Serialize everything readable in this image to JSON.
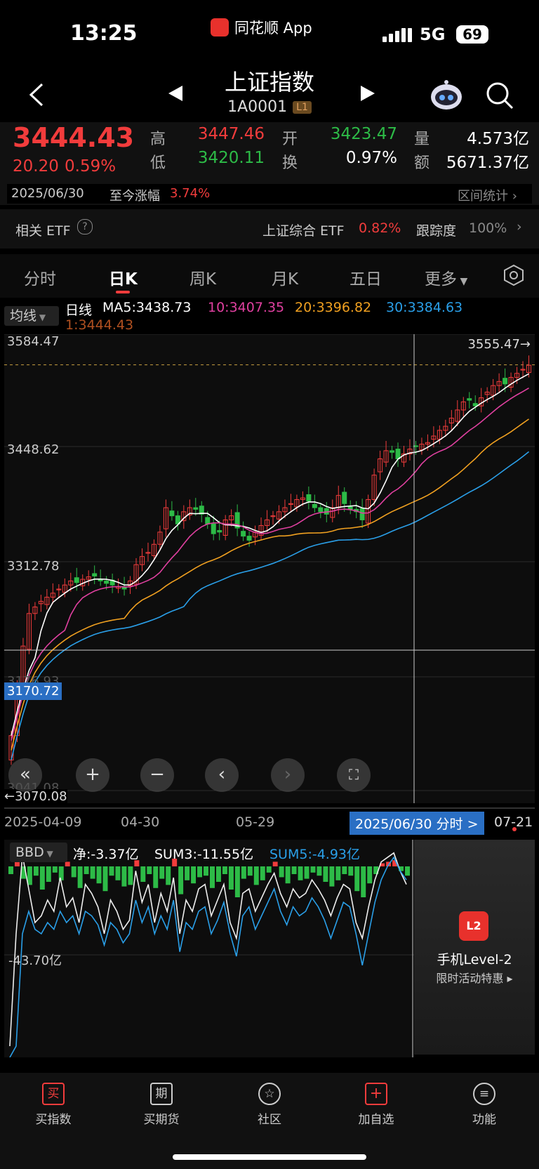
{
  "status": {
    "time": "13:25",
    "app_name": "同花顺 App",
    "network": "5G",
    "battery": "69"
  },
  "header": {
    "title": "上证指数",
    "code": "1A0001",
    "level_badge": "L1"
  },
  "quote": {
    "price": "3444.43",
    "change": "20.20",
    "change_pct": "0.59%",
    "high_label": "高",
    "high": "3447.46",
    "low_label": "低",
    "low": "3420.11",
    "open_label": "开",
    "open": "3423.47",
    "turnover_label": "换",
    "turnover": "0.97%",
    "volume_label": "量",
    "volume": "4.573亿",
    "amount_label": "额",
    "amount": "5671.37亿"
  },
  "datebar": {
    "date": "2025/06/30",
    "cum_label": "至今涨幅",
    "cum_value": "3.74%",
    "range_stats": "区间统计"
  },
  "etf": {
    "label": "相关 ETF",
    "name": "上证综合 ETF",
    "change": "0.82%",
    "track_label": "跟踪度",
    "track_value": "100%"
  },
  "tabs": [
    "分时",
    "日K",
    "周K",
    "月K",
    "五日",
    "更多"
  ],
  "ma": {
    "selector": "均线",
    "period": "日线",
    "ma5": "MA5:3438.73",
    "ma10": "10:3407.35",
    "ma20": "20:3396.82",
    "ma30": "30:3384.63",
    "ma1": "1:3444.43",
    "colors": {
      "ma5": "#ffffff",
      "ma10": "#e040a0",
      "ma20": "#f0a020",
      "ma30": "#2a9fe8"
    }
  },
  "chart": {
    "y_labels": [
      "3584.47",
      "3448.62",
      "3312.78",
      "3176.93",
      "3041.08"
    ],
    "crosshair_value": "3170.72",
    "max_label": "3555.47→",
    "min_label": "←3070.08",
    "x_labels": [
      "2025-04-09",
      "04-30",
      "05-29",
      "07-21"
    ],
    "selected_date": "2025/06/30 分时 >"
  },
  "chart_data": {
    "type": "candlestick",
    "title": "",
    "x_range": [
      "2025-04-09",
      "2025-07-21"
    ],
    "ylim": [
      3041.08,
      3584.47
    ],
    "close_series": [
      3100,
      3160,
      3210,
      3250,
      3258,
      3265,
      3270,
      3275,
      3280,
      3285,
      3290,
      3288,
      3292,
      3295,
      3296,
      3290,
      3287,
      3285,
      3283,
      3280,
      3290,
      3310,
      3320,
      3325,
      3335,
      3350,
      3380,
      3370,
      3360,
      3375,
      3380,
      3378,
      3372,
      3360,
      3348,
      3350,
      3365,
      3370,
      3355,
      3345,
      3340,
      3350,
      3358,
      3365,
      3370,
      3375,
      3380,
      3385,
      3390,
      3392,
      3388,
      3380,
      3375,
      3372,
      3380,
      3395,
      3385,
      3378,
      3375,
      3365,
      3390,
      3420,
      3440,
      3450,
      3448,
      3440,
      3446,
      3452,
      3455,
      3458,
      3460,
      3468,
      3475,
      3480,
      3490,
      3500,
      3510,
      3512,
      3505,
      3515,
      3522,
      3530,
      3535,
      3532,
      3540,
      3545,
      3550,
      3555
    ],
    "ma5": "3438.73",
    "ma10": "3407.35",
    "ma20": "3396.82",
    "ma30": "3384.63",
    "max": 3555.47,
    "min": 3070.08
  },
  "bbd": {
    "selector": "BBD",
    "net": "净:-3.37亿",
    "sum3": "SUM3:-11.55亿",
    "sum5": "SUM5:-4.93亿",
    "y_label": "-43.70亿",
    "values": [
      -5,
      3,
      -8,
      -12,
      -6,
      -15,
      -10,
      -4,
      -9,
      3,
      -7,
      -14,
      -5,
      -8,
      -11,
      -16,
      -6,
      -9,
      -13,
      -12,
      4,
      -10,
      -5,
      -14,
      -8,
      -12,
      5,
      -18,
      -9,
      -11,
      -7,
      -6,
      -14,
      -10,
      -5,
      -15,
      -20,
      -8,
      -6,
      -12,
      -9,
      -4,
      3,
      -7,
      -11,
      -5,
      -9,
      -8,
      -4,
      -6,
      -10,
      -13,
      -9,
      -5,
      -6,
      -16,
      -20,
      -11,
      -5,
      2,
      3,
      4,
      -3,
      -6
    ],
    "sum3_series": [
      -80,
      -30,
      5,
      -10,
      -25,
      -22,
      -15,
      -20,
      -5,
      -18,
      -14,
      -25,
      -8,
      -12,
      -18,
      -30,
      -15,
      -20,
      -28,
      -24,
      -2,
      -16,
      -8,
      -25,
      -12,
      -20,
      -5,
      -30,
      -15,
      -20,
      -10,
      -8,
      -22,
      -15,
      -8,
      -25,
      -32,
      -12,
      -10,
      -20,
      -14,
      -8,
      -3,
      -12,
      -18,
      -10,
      -14,
      -12,
      -6,
      -10,
      -15,
      -22,
      -14,
      -8,
      -10,
      -25,
      -32,
      -18,
      -6,
      2,
      4,
      6,
      -2,
      -8
    ],
    "sum5_series": [
      -85,
      -80,
      -30,
      -20,
      -28,
      -30,
      -25,
      -28,
      -20,
      -25,
      -22,
      -30,
      -20,
      -22,
      -26,
      -35,
      -25,
      -28,
      -34,
      -30,
      -15,
      -25,
      -18,
      -30,
      -22,
      -28,
      -15,
      -38,
      -25,
      -28,
      -20,
      -18,
      -30,
      -24,
      -16,
      -30,
      -40,
      -22,
      -18,
      -28,
      -22,
      -16,
      -10,
      -20,
      -26,
      -18,
      -22,
      -20,
      -14,
      -18,
      -24,
      -32,
      -24,
      -16,
      -18,
      -30,
      -44,
      -30,
      -16,
      -6,
      0,
      4,
      -2,
      -6
    ]
  },
  "level2": {
    "title": "手机Level-2",
    "subtitle": "限时活动特惠",
    "badge": "L2"
  },
  "bottomnav": [
    {
      "label": "买指数",
      "icon": "买"
    },
    {
      "label": "买期货",
      "icon": "期"
    },
    {
      "label": "社区",
      "icon": "☆"
    },
    {
      "label": "加自选",
      "icon": "+"
    },
    {
      "label": "功能",
      "icon": "≡"
    }
  ]
}
